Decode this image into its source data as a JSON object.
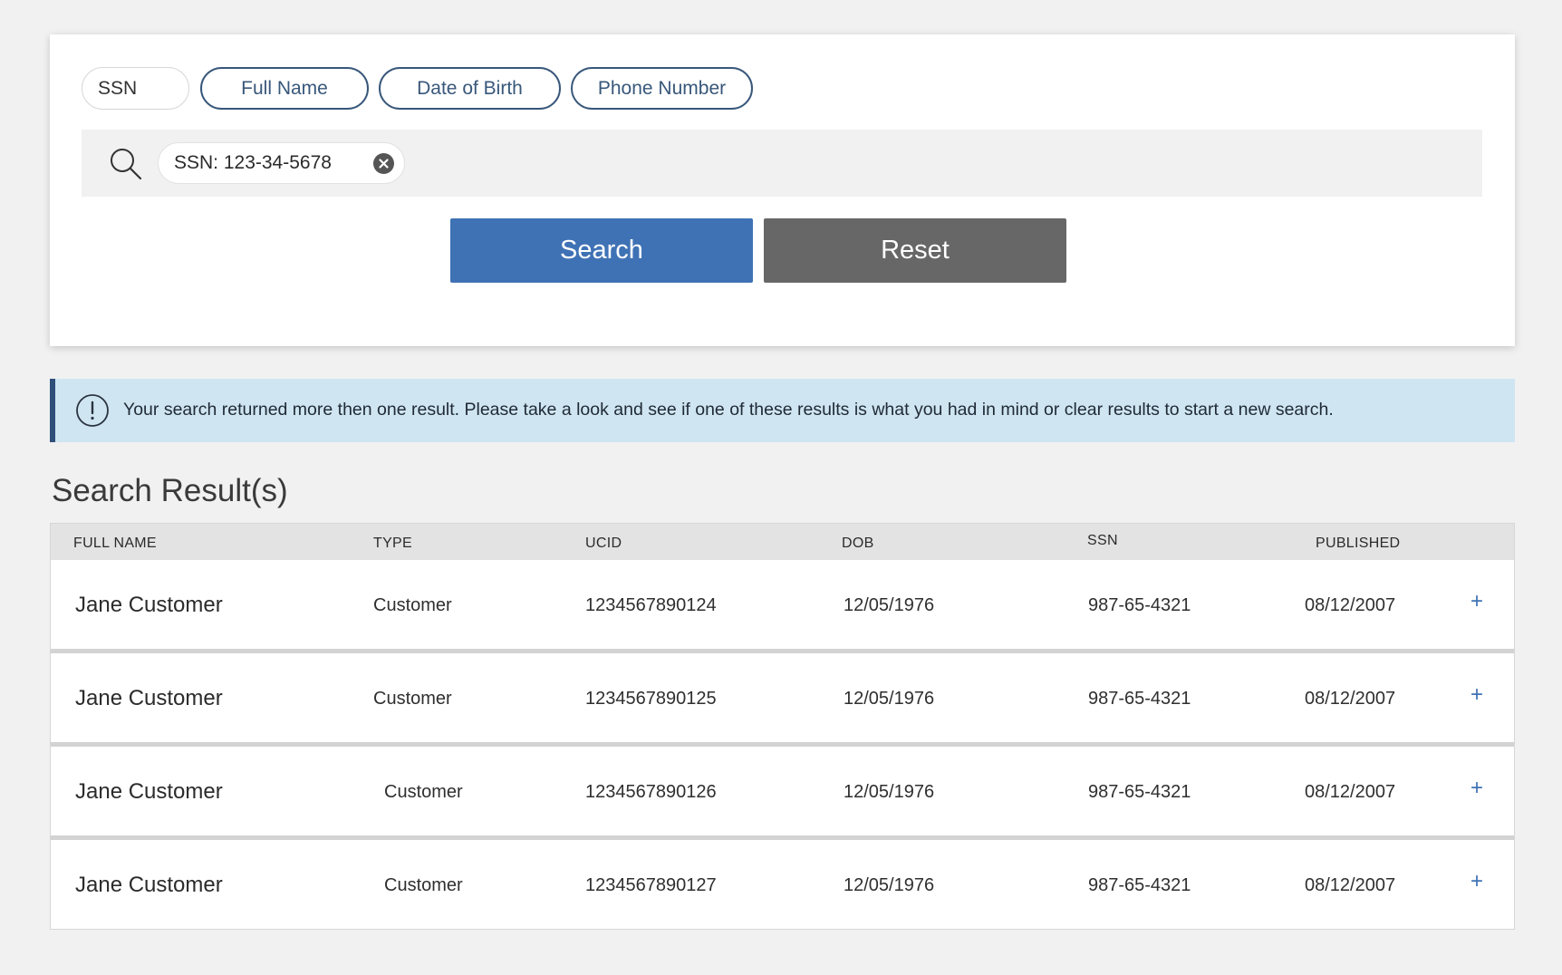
{
  "filter_chips": {
    "ssn": "SSN",
    "full_name": "Full Name",
    "date_of_birth": "Date of Birth",
    "phone_number": "Phone Number"
  },
  "search": {
    "token_label": "SSN: 123-34-5678",
    "search_button": "Search",
    "reset_button": "Reset"
  },
  "alert": {
    "message": "Your search returned more then one result. Please take a look and see if one of these results is what you had in mind or clear results to start a new search."
  },
  "results": {
    "title": "Search Result(s)",
    "headers": {
      "full_name": "FULL NAME",
      "type": "TYPE",
      "ucid": "UCID",
      "dob": "DOB",
      "ssn": "SSN",
      "published": "PUBLISHED"
    },
    "rows": [
      {
        "name": "Jane Customer",
        "type": "Customer",
        "ucid": "1234567890124",
        "dob": "12/05/1976",
        "ssn": "987-65-4321",
        "published": "08/12/2007",
        "action": "+"
      },
      {
        "name": "Jane Customer",
        "type": "Customer",
        "ucid": "1234567890125",
        "dob": "12/05/1976",
        "ssn": "987-65-4321",
        "published": "08/12/2007",
        "action": "+"
      },
      {
        "name": "Jane Customer",
        "type": "Customer",
        "ucid": "1234567890126",
        "dob": "12/05/1976",
        "ssn": "987-65-4321",
        "published": "08/12/2007",
        "action": "+"
      },
      {
        "name": "Jane Customer",
        "type": "Customer",
        "ucid": "1234567890127",
        "dob": "12/05/1976",
        "ssn": "987-65-4321",
        "published": "08/12/2007",
        "action": "+"
      }
    ]
  },
  "colors": {
    "primary": "#3f72b5",
    "reset": "#666766",
    "alert_bg": "#cfe5f1",
    "alert_border": "#2f4f7a"
  },
  "icons": {
    "search": "search-icon",
    "clear_token": "close-circle-icon",
    "alert": "info-icon",
    "expand": "plus-icon"
  }
}
